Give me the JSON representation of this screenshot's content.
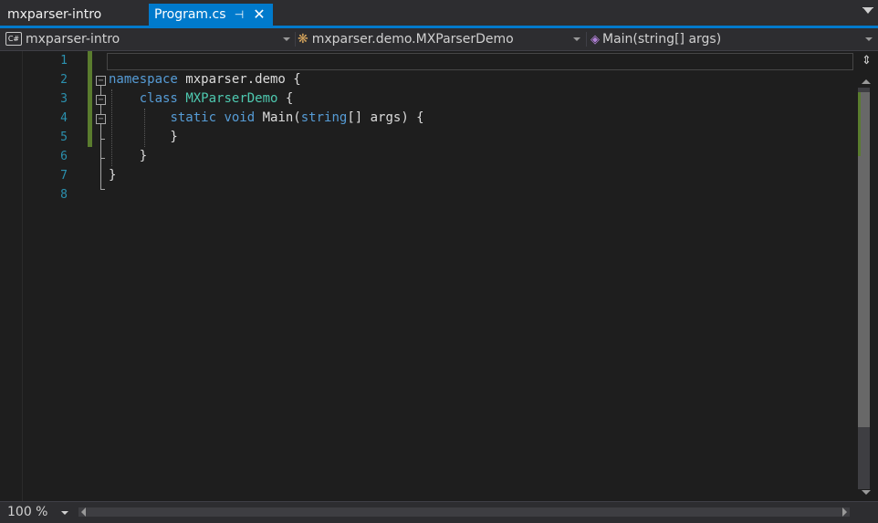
{
  "tabs": {
    "inactive_label": "mxparser-intro",
    "active_label": "Program.cs",
    "pin_glyph": "⊣",
    "close_glyph": "✕"
  },
  "navbar": {
    "project": "mxparser-intro",
    "project_icon": "C#",
    "type": "mxparser.demo.MXParserDemo",
    "member": "Main(string[] args)"
  },
  "editor": {
    "line_numbers": [
      "1",
      "2",
      "3",
      "4",
      "5",
      "6",
      "7",
      "8"
    ],
    "code": {
      "l2_kw": "namespace",
      "l2_rest": " mxparser.demo {",
      "l3_indent": "    ",
      "l3_kw": "class",
      "l3_space": " ",
      "l3_type": "MXParserDemo",
      "l3_rest": " {",
      "l4_indent": "        ",
      "l4_kw": "static void",
      "l4_mid": " Main(",
      "l4_kw2": "string",
      "l4_rest": "[] args) {",
      "l5": "        }",
      "l6": "    }",
      "l7": "}"
    }
  },
  "statusbar": {
    "zoom": "100 %"
  },
  "colors": {
    "background": "#1e1e1e",
    "chrome": "#2d2d30",
    "accent": "#007acc",
    "keyword": "#569cd6",
    "type": "#4ec9b0",
    "line_number": "#2b91af",
    "change_marker": "#5a7c2e"
  }
}
